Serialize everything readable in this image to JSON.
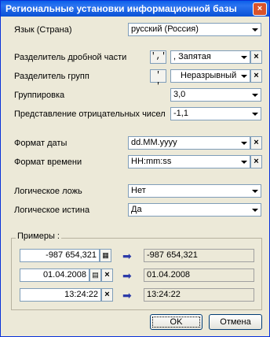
{
  "window": {
    "title": "Региональные установки информационной базы",
    "close_label": "×"
  },
  "fields": {
    "language": {
      "label": "Язык (Страна)",
      "value": "русский (Россия)"
    },
    "decimal_separator": {
      "label": "Разделитель дробной части",
      "quote": "','",
      "value": ", Запятая"
    },
    "group_separator": {
      "label": "Разделитель групп",
      "quote": "' '",
      "value": "Неразрывный п"
    },
    "grouping": {
      "label": "Группировка",
      "value": "3,0"
    },
    "negative": {
      "label": "Представление отрицательных чисел",
      "value": "-1,1"
    },
    "date_format": {
      "label": "Формат даты",
      "value": "dd.MM.yyyy"
    },
    "time_format": {
      "label": "Формат времени",
      "value": "HH:mm:ss"
    },
    "false_value": {
      "label": "Логическое ложь",
      "value": "Нет"
    },
    "true_value": {
      "label": "Логическое истина",
      "value": "Да"
    }
  },
  "examples": {
    "label": "Примеры :",
    "number": {
      "input": "-987 654,321",
      "output": "-987 654,321"
    },
    "date": {
      "input": "01.04.2008",
      "output": "01.04.2008"
    },
    "time": {
      "input": "13:24:22",
      "output": "13:24:22"
    },
    "arrow": "➡"
  },
  "buttons": {
    "ok": "OK",
    "cancel": "Отмена"
  },
  "clear_symbol": "×"
}
